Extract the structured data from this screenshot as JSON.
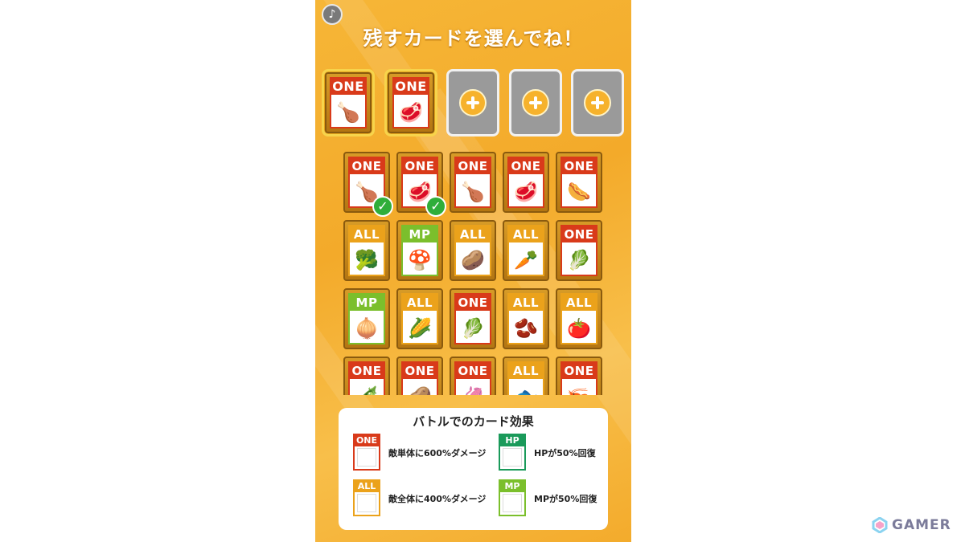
{
  "header": {
    "title": "残すカードを選んでね！",
    "mute_icon": "sound-off-icon"
  },
  "colors": {
    "one": "#d93a1a",
    "all": "#eba21b",
    "mp": "#7bbf2c",
    "hp": "#1a9a5a"
  },
  "selected_slots": [
    {
      "type": "ONE",
      "food": "chicken",
      "glyph": "🍗"
    },
    {
      "type": "ONE",
      "food": "steak",
      "glyph": "🥩"
    },
    {
      "type": "empty"
    },
    {
      "type": "empty"
    },
    {
      "type": "empty"
    }
  ],
  "grid": [
    [
      {
        "type": "ONE",
        "glyph": "🍗",
        "checked": true
      },
      {
        "type": "ONE",
        "glyph": "🥩",
        "checked": true
      },
      {
        "type": "ONE",
        "glyph": "🍗"
      },
      {
        "type": "ONE",
        "glyph": "🥩"
      },
      {
        "type": "ONE",
        "glyph": "🌭"
      }
    ],
    [
      {
        "type": "ALL",
        "glyph": "🥦"
      },
      {
        "type": "MP",
        "glyph": "🍄"
      },
      {
        "type": "ALL",
        "glyph": "🥔"
      },
      {
        "type": "ALL",
        "glyph": "🥕"
      },
      {
        "type": "ONE",
        "glyph": "🥬"
      }
    ],
    [
      {
        "type": "MP",
        "glyph": "🧅"
      },
      {
        "type": "ALL",
        "glyph": "🌽"
      },
      {
        "type": "ONE",
        "glyph": "🥬"
      },
      {
        "type": "ALL",
        "glyph": "🫘"
      },
      {
        "type": "ALL",
        "glyph": "🍅"
      }
    ],
    [
      {
        "type": "ONE",
        "glyph": "🫛"
      },
      {
        "type": "ONE",
        "glyph": "🥔"
      },
      {
        "type": "ONE",
        "glyph": "🦑"
      },
      {
        "type": "ALL",
        "glyph": "🐟"
      },
      {
        "type": "ONE",
        "glyph": "🦐"
      }
    ]
  ],
  "legend": {
    "title": "バトルでのカード効果",
    "items": [
      {
        "tag": "ONE",
        "text": "敵単体に600%ダメージ"
      },
      {
        "tag": "HP",
        "text": "HPが50%回復"
      },
      {
        "tag": "ALL",
        "text": "敵全体に400%ダメージ"
      },
      {
        "tag": "MP",
        "text": "MPが50%回復"
      }
    ]
  },
  "watermark": {
    "text": "GAMER"
  }
}
